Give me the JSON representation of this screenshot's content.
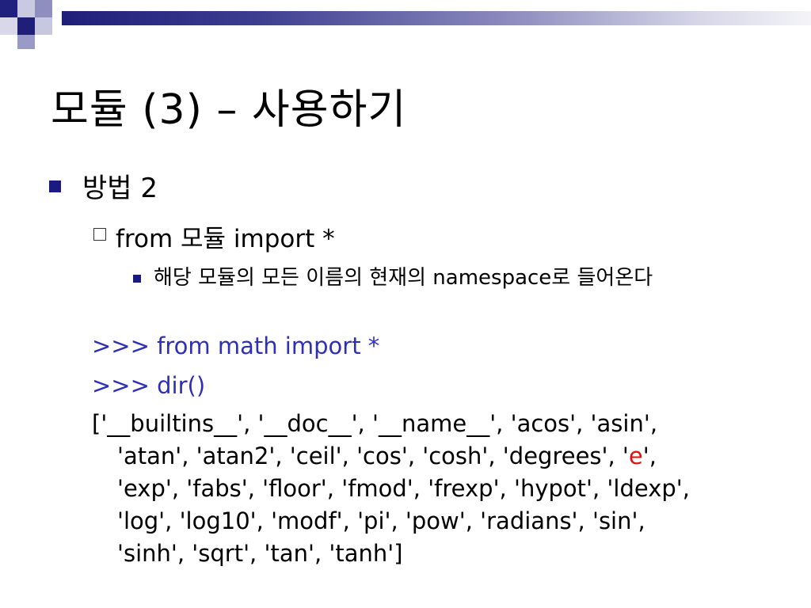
{
  "slide": {
    "title": "모듈 (3) – 사용하기",
    "bullet_level1": "방법 2",
    "bullet_level2": "from 모듈 import *",
    "bullet_level3": "해당 모듈의 모든 이름의 현재의 namespace로 들어온다",
    "code_line1": ">>> from math import *",
    "code_line2": ">>> dir()",
    "output": {
      "line1": "['__builtins__', '__doc__', '__name__', 'acos', 'asin',",
      "line2_before": "'atan', 'atan2', 'ceil', 'cos', 'cosh', 'degrees', '",
      "line2_highlight": "e",
      "line2_after": "',",
      "line3": "'exp', 'fabs', 'floor', 'fmod', 'frexp', 'hypot', 'ldexp',",
      "line4": "'log', 'log10', 'modf', 'pi', 'pow', 'radians', 'sin',",
      "line5": "'sinh', 'sqrt', 'tan', 'tanh']"
    }
  },
  "colors": {
    "accent_navy": "#1a1a80",
    "code_blue": "#2f2fb6",
    "highlight_red": "#e01010"
  },
  "icons": {
    "corner": "square-decoration-icon",
    "level1": "filled-square-bullet-icon",
    "level2": "hollow-square-bullet-icon",
    "level3": "small-square-bullet-icon"
  }
}
